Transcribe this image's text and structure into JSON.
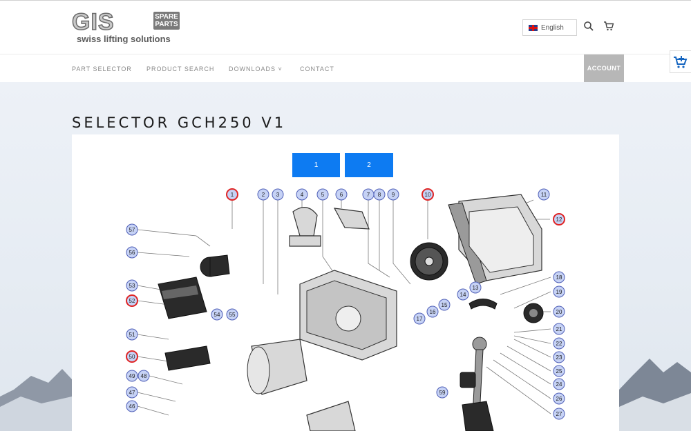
{
  "brand": {
    "logo_text": "GIS",
    "badge_line1": "SPARE",
    "badge_line2": "PARTS",
    "tagline": "swiss lifting solutions"
  },
  "header": {
    "language": "English"
  },
  "nav": {
    "items": [
      "PART SELECTOR",
      "PRODUCT SEARCH",
      "DOWNLOADS",
      "CONTACT"
    ],
    "downloads_caret": "˅",
    "account": "ACCOUNT"
  },
  "page": {
    "title": "SELECTOR GCH250 V1"
  },
  "pagination": [
    "1",
    "2"
  ],
  "diagram": {
    "callouts_top": [
      "1",
      "2",
      "3",
      "4",
      "5",
      "6",
      "7",
      "8",
      "9",
      "10",
      "11",
      "12"
    ],
    "callouts_left": [
      "57",
      "56",
      "53",
      "52",
      "54",
      "55",
      "51",
      "50",
      "49",
      "48",
      "47",
      "46"
    ],
    "callouts_right": [
      "13",
      "14",
      "15",
      "16",
      "17",
      "18",
      "19",
      "20",
      "21",
      "22",
      "23",
      "24",
      "25",
      "26",
      "27",
      "59"
    ],
    "highlighted": [
      "1",
      "10",
      "12",
      "52",
      "50"
    ]
  }
}
